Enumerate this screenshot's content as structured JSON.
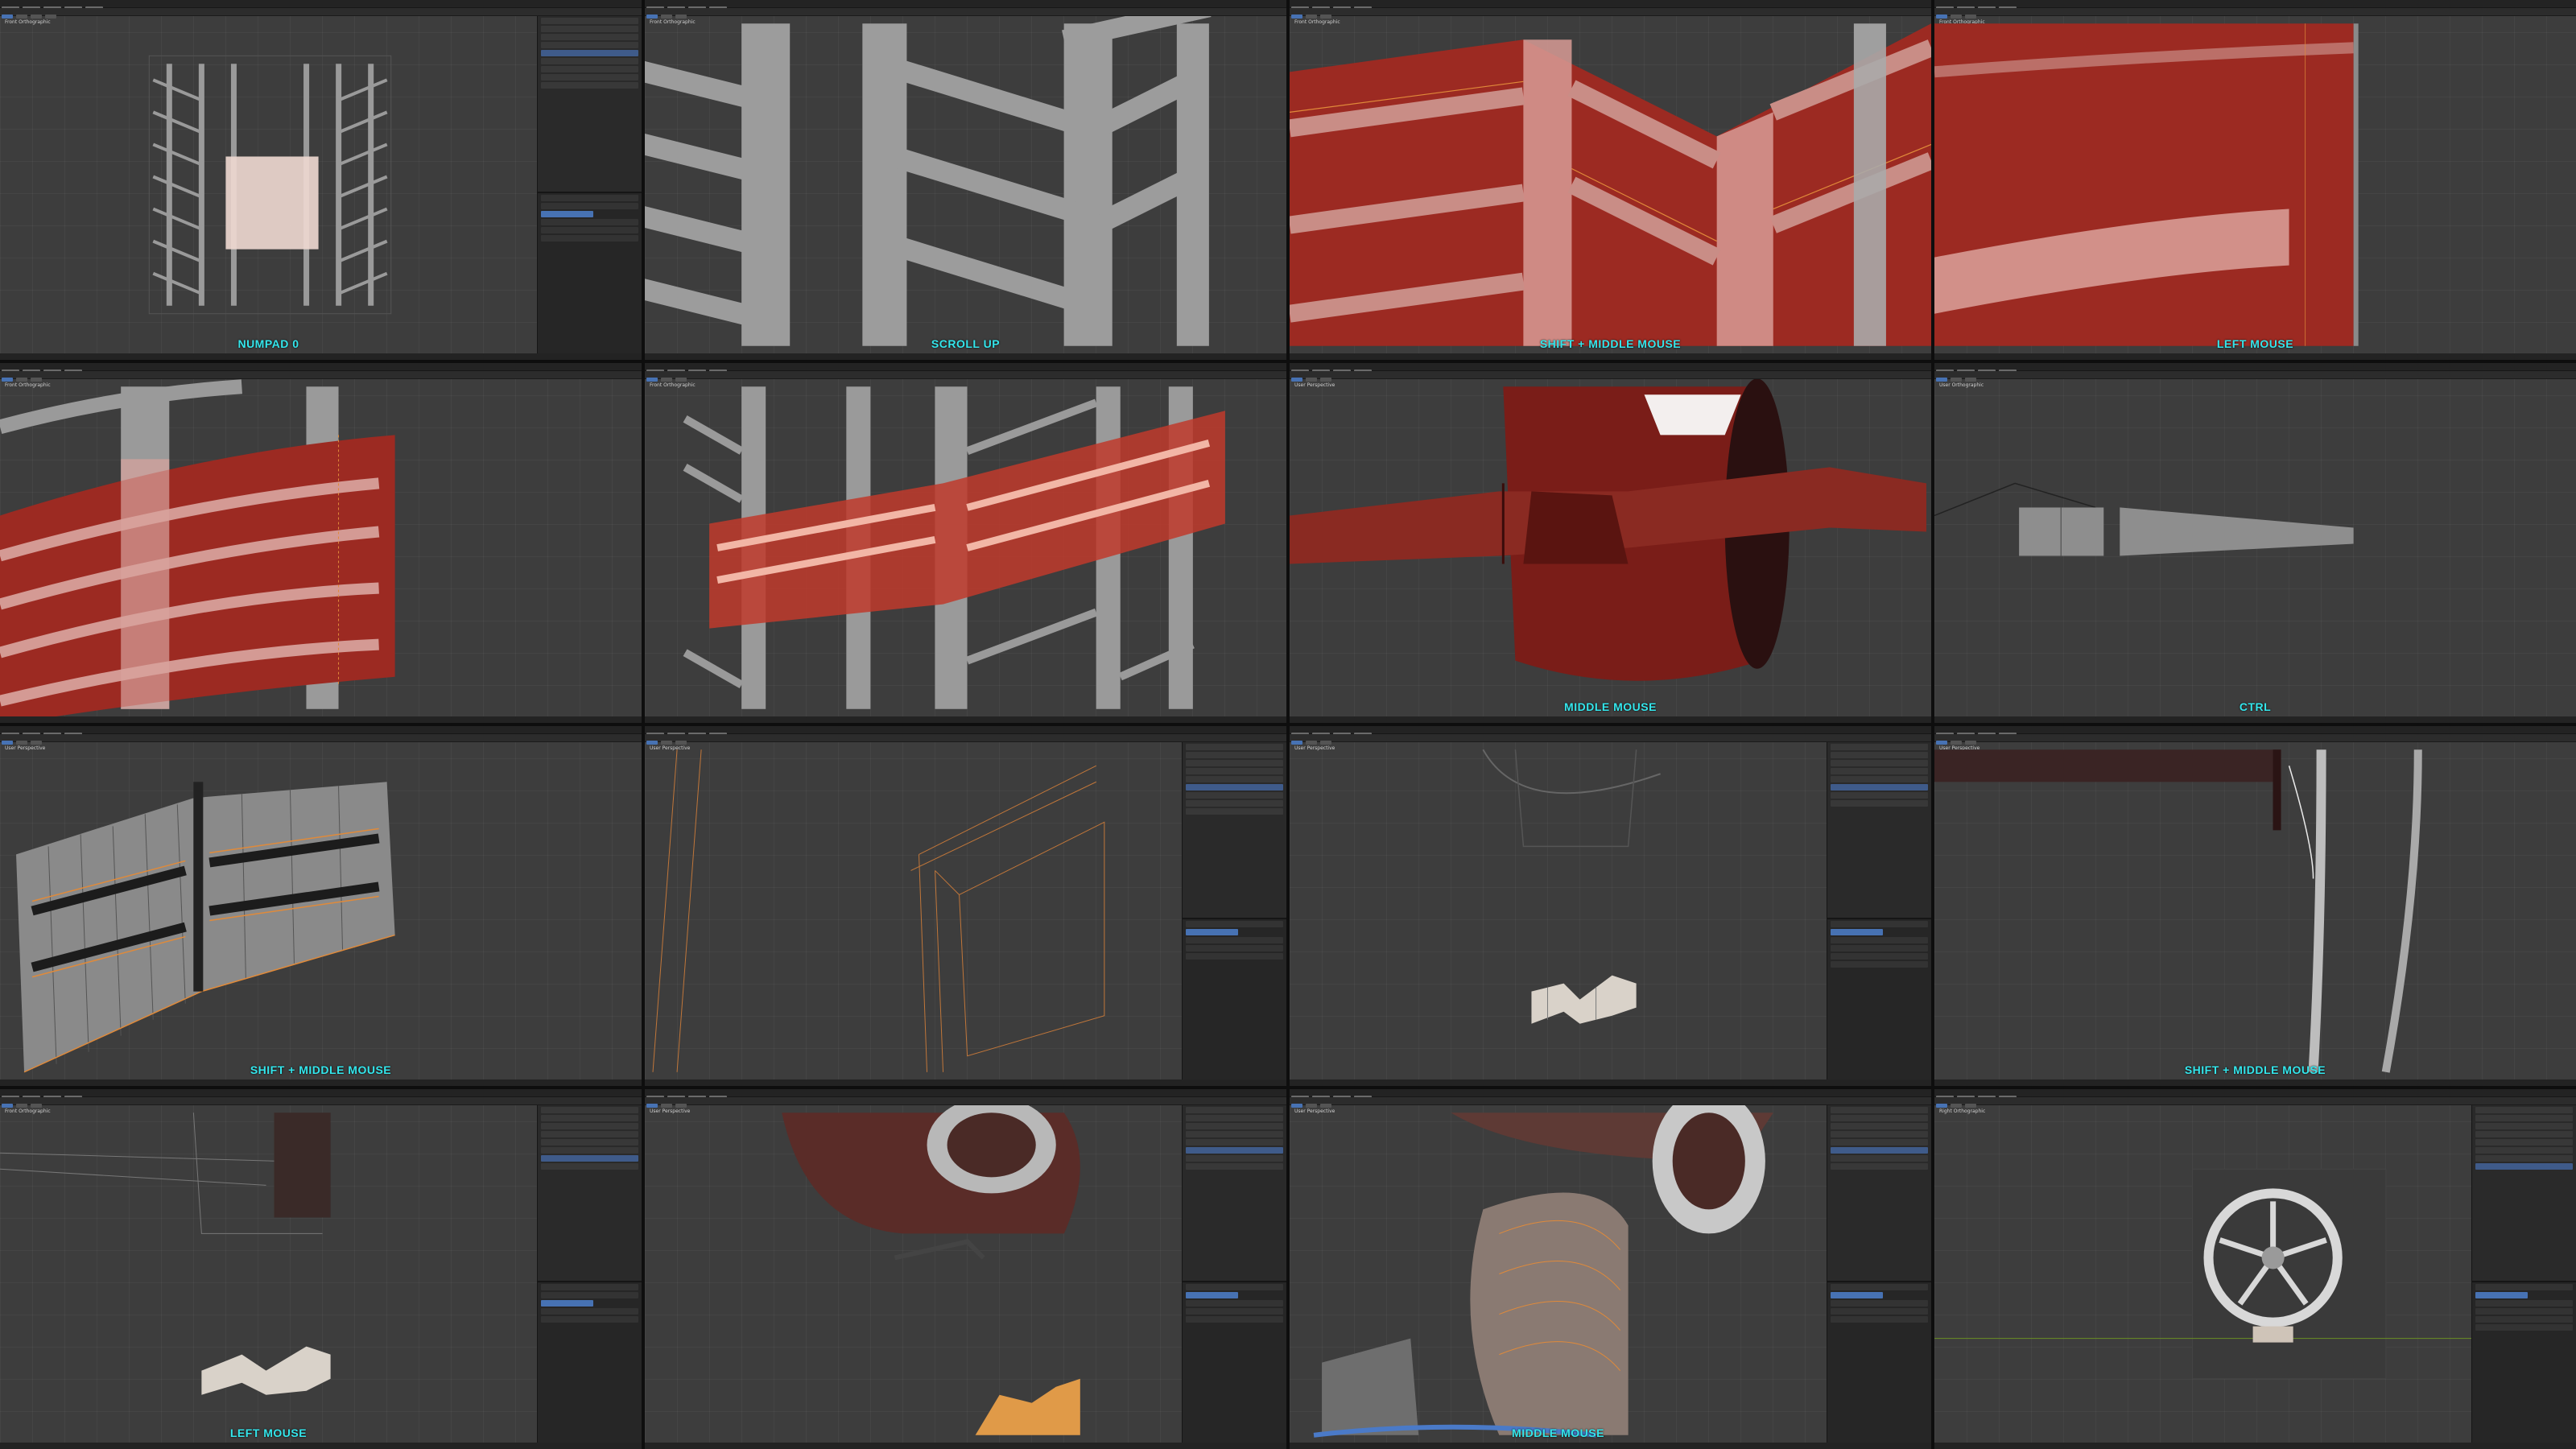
{
  "app": "Blender",
  "panels": [
    {
      "id": "p1",
      "caption": "NUMPAD 0",
      "viewport_label": "Front Orthographic",
      "stats": "Scene Collection",
      "has_outliner": true
    },
    {
      "id": "p2",
      "caption": "SCROLL UP",
      "viewport_label": "Front Orthographic",
      "stats": "",
      "has_outliner": false
    },
    {
      "id": "p3",
      "caption": "SHIFT + MIDDLE MOUSE",
      "viewport_label": "Front Orthographic",
      "stats": "",
      "has_outliner": false
    },
    {
      "id": "p4",
      "caption": "LEFT MOUSE",
      "viewport_label": "Front Orthographic",
      "stats": "",
      "has_outliner": false
    },
    {
      "id": "p5",
      "caption": "",
      "viewport_label": "Front Orthographic",
      "stats": "",
      "has_outliner": false
    },
    {
      "id": "p6",
      "caption": "",
      "viewport_label": "Front Orthographic",
      "stats": "",
      "has_outliner": false
    },
    {
      "id": "p7",
      "caption": "MIDDLE MOUSE",
      "viewport_label": "User Perspective",
      "stats": "",
      "has_outliner": false
    },
    {
      "id": "p8",
      "caption": "CTRL",
      "viewport_label": "User Orthographic",
      "stats": "",
      "has_outliner": false
    },
    {
      "id": "p9",
      "caption": "SHIFT + MIDDLE MOUSE",
      "viewport_label": "User Perspective",
      "stats": "",
      "has_outliner": false
    },
    {
      "id": "p10",
      "caption": "",
      "viewport_label": "User Perspective",
      "stats": "",
      "has_outliner": true
    },
    {
      "id": "p11",
      "caption": "",
      "viewport_label": "User Perspective",
      "stats": "",
      "has_outliner": true
    },
    {
      "id": "p12",
      "caption": "SHIFT + MIDDLE MOUSE",
      "viewport_label": "User Perspective",
      "stats": "",
      "has_outliner": false
    },
    {
      "id": "p13",
      "caption": "LEFT MOUSE",
      "viewport_label": "Front Orthographic",
      "stats": "",
      "has_outliner": true
    },
    {
      "id": "p14",
      "caption": "",
      "viewport_label": "User Perspective",
      "stats": "",
      "has_outliner": true
    },
    {
      "id": "p15",
      "caption": "MIDDLE MOUSE",
      "viewport_label": "User Perspective",
      "stats": "",
      "has_outliner": true
    },
    {
      "id": "p16",
      "caption": "",
      "viewport_label": "Right Orthographic",
      "stats": "",
      "has_outliner": true
    }
  ],
  "colors": {
    "caption": "#34e6ec",
    "selection_red": "#9c2a22",
    "mesh_grey": "#9a9a9a",
    "viewport_bg": "#3d3d3d"
  }
}
